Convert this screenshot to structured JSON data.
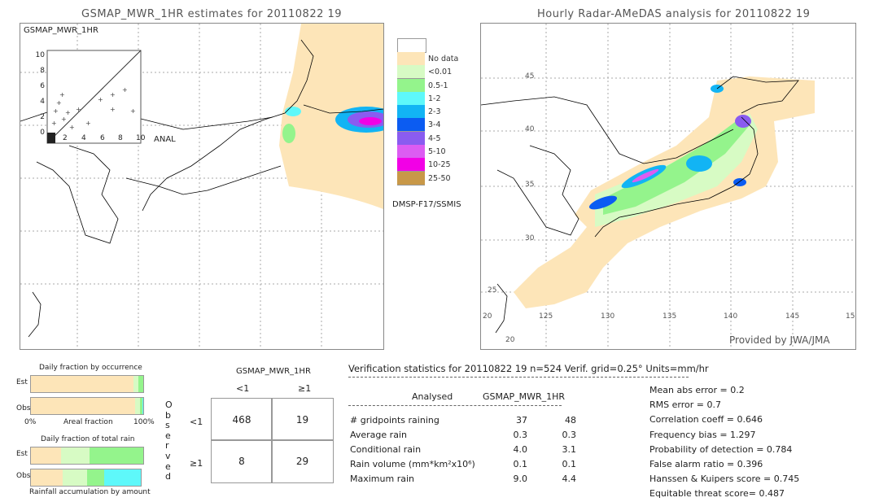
{
  "left_map": {
    "title": "GSMAP_MWR_1HR estimates for 20110822 19",
    "inset_ylabel": "GSMAP_MWR_1HR",
    "inset_xlabel": "ANAL",
    "inset_yticks": [
      "10",
      "8",
      "6",
      "4",
      "2",
      "0"
    ],
    "inset_xticks": [
      "2",
      "4",
      "6",
      "8",
      "10"
    ],
    "sensor_label": "DMSP-F17/SSMIS"
  },
  "legend": {
    "items": [
      {
        "label": "No data",
        "color": "#ffffff"
      },
      {
        "label": "<0.01",
        "color": "#fde5b8"
      },
      {
        "label": "0.5-1",
        "color": "#d7fbc4"
      },
      {
        "label": "1-2",
        "color": "#94f48c"
      },
      {
        "label": "2-3",
        "color": "#5ef8fa"
      },
      {
        "label": "3-4",
        "color": "#12b4f4"
      },
      {
        "label": "4-5",
        "color": "#0b5cf2"
      },
      {
        "label": "5-10",
        "color": "#8a5cf0"
      },
      {
        "label": "10-25",
        "color": "#dc5cf2"
      },
      {
        "label": "25-50",
        "color": "#f200e6"
      },
      {
        "label": "",
        "color": "#c89848"
      }
    ]
  },
  "right_map": {
    "title": "Hourly Radar-AMeDAS analysis for 20110822 19",
    "lat_labels": [
      "45",
      "40",
      "35",
      "30",
      "25",
      "20"
    ],
    "lon_labels": [
      "125",
      "130",
      "135",
      "140",
      "145",
      "15"
    ],
    "bottom_lat_label": "20",
    "credit": "Provided by JWA/JMA"
  },
  "occurrence": {
    "title": "Daily fraction by occurrence",
    "est_label": "Est",
    "obs_label": "Obs",
    "axis_left": "0%",
    "axis_mid": "Areal fraction",
    "axis_right": "100%",
    "est_segments": [
      {
        "pct": 91,
        "color": "#fde5b8"
      },
      {
        "pct": 5,
        "color": "#d7fbc4"
      },
      {
        "pct": 4,
        "color": "#94f48c"
      }
    ],
    "obs_segments": [
      {
        "pct": 93,
        "color": "#fde5b8"
      },
      {
        "pct": 4,
        "color": "#d7fbc4"
      },
      {
        "pct": 2,
        "color": "#94f48c"
      },
      {
        "pct": 1,
        "color": "#5ef8fa"
      }
    ]
  },
  "total_rain": {
    "title": "Daily fraction of total rain",
    "est_label": "Est",
    "obs_label": "Obs",
    "footer": "Rainfall accumulation by amount",
    "est_segments": [
      {
        "pct": 27,
        "color": "#fde5b8"
      },
      {
        "pct": 25,
        "color": "#d7fbc4"
      },
      {
        "pct": 48,
        "color": "#94f48c"
      }
    ],
    "obs_segments": [
      {
        "pct": 29,
        "color": "#fde5b8"
      },
      {
        "pct": 22,
        "color": "#d7fbc4"
      },
      {
        "pct": 16,
        "color": "#94f48c"
      },
      {
        "pct": 33,
        "color": "#5ef8fa"
      }
    ]
  },
  "contingency": {
    "title": "GSMAP_MWR_1HR",
    "col_labels": [
      "<1",
      "≥1"
    ],
    "row_labels": [
      "<1",
      "≥1"
    ],
    "side_label": "Observed",
    "cells": [
      [
        "468",
        "19"
      ],
      [
        "8",
        "29"
      ]
    ]
  },
  "stats": {
    "header": "Verification statistics for 20110822 19   n=524   Verif. grid=0.25°   Units=mm/hr",
    "col_analysed": "Analysed",
    "col_est": "GSMAP_MWR_1HR",
    "rows": [
      {
        "label": "# gridpoints raining",
        "a": "37",
        "b": "48"
      },
      {
        "label": "Average rain",
        "a": "0.3",
        "b": "0.3"
      },
      {
        "label": "Conditional rain",
        "a": "4.0",
        "b": "3.1"
      },
      {
        "label": "Rain volume (mm*km²x10⁶)",
        "a": "0.1",
        "b": "0.1"
      },
      {
        "label": "Maximum rain",
        "a": "9.0",
        "b": "4.4"
      }
    ],
    "scores": [
      "Mean abs error = 0.2",
      "RMS error = 0.7",
      "Correlation coeff = 0.646",
      "Frequency bias = 1.297",
      "Probability of detection = 0.784",
      "False alarm ratio = 0.396",
      "Hanssen & Kuipers score = 0.745",
      "Equitable threat score= 0.487"
    ]
  }
}
